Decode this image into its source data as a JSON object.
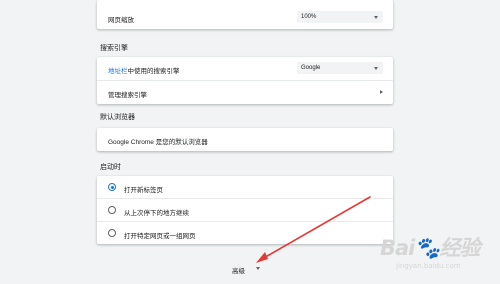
{
  "appearance": {
    "page_zoom_label": "网页缩放",
    "page_zoom_value": "100%"
  },
  "search_engine": {
    "title": "搜索引擎",
    "address_bar_label_link": "地址栏",
    "address_bar_label_rest": "中使用的搜索引擎",
    "engine_value": "Google",
    "manage_label": "管理搜索引擎"
  },
  "default_browser": {
    "title": "默认浏览器",
    "text": "Google Chrome 是您的默认浏览器"
  },
  "startup": {
    "title": "启动时",
    "options": [
      {
        "label": "打开新标签页",
        "selected": true
      },
      {
        "label": "从上次停下的地方继续",
        "selected": false
      },
      {
        "label": "打开特定网页或一组网页",
        "selected": false
      }
    ]
  },
  "advanced_label": "高级",
  "watermark": {
    "logo": "Bai🐾经验",
    "url": "jingyan.baidu.com"
  },
  "colors": {
    "accent": "#1a73e8",
    "arrow": "#e53935"
  }
}
